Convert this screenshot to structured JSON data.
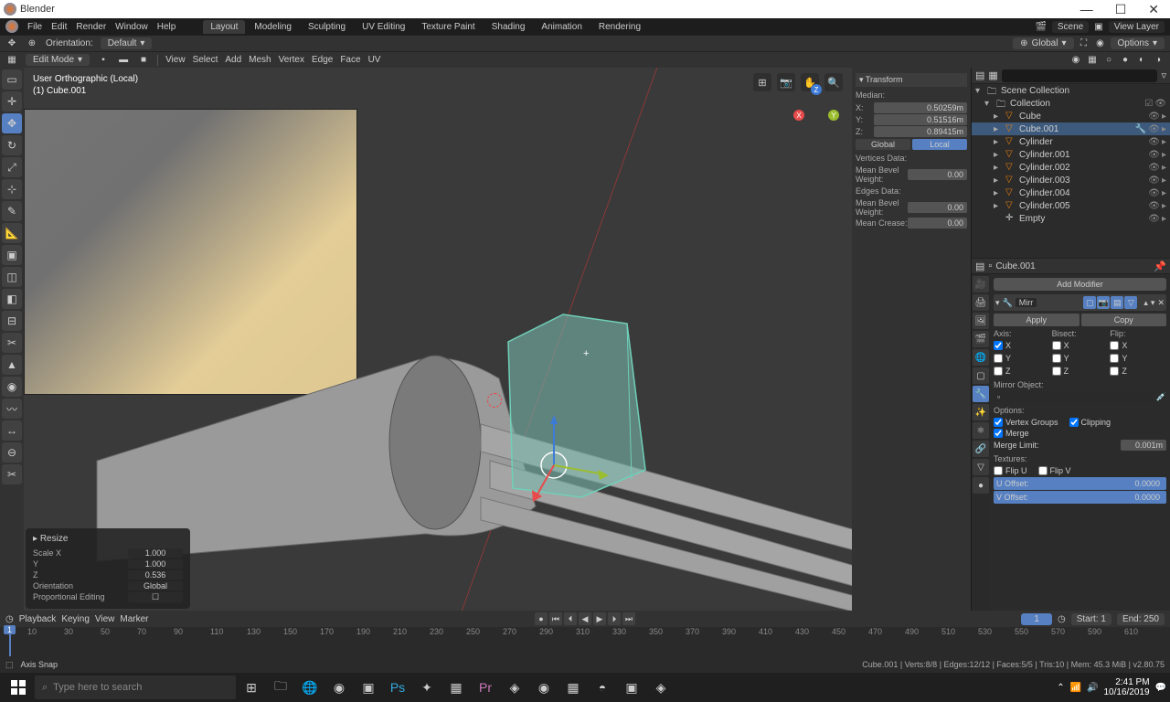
{
  "app": {
    "title": "Blender"
  },
  "winbuttons": {
    "min": "—",
    "max": "☐",
    "close": "✕"
  },
  "topmenu": {
    "items": [
      "File",
      "Edit",
      "Render",
      "Window",
      "Help"
    ]
  },
  "workspaces": [
    "Layout",
    "Modeling",
    "Sculpting",
    "UV Editing",
    "Texture Paint",
    "Shading",
    "Animation",
    "Rendering"
  ],
  "scene": {
    "label": "Scene",
    "viewlayer": "View Layer"
  },
  "toolbar": {
    "orientation_lbl": "Orientation:",
    "orientation_val": "Default",
    "transform_orient": "Global",
    "options": "Options"
  },
  "editmenu": {
    "mode": "Edit Mode",
    "items": [
      "View",
      "Select",
      "Add",
      "Mesh",
      "Vertex",
      "Edge",
      "Face",
      "UV"
    ]
  },
  "viewport": {
    "line1": "User Orthographic (Local)",
    "line2": "(1) Cube.001"
  },
  "npanel": {
    "transform": "Transform",
    "median": "Median:",
    "x": "X:",
    "xv": "0.50259m",
    "y": "Y:",
    "yv": "0.51516m",
    "z": "Z:",
    "zv": "0.89415m",
    "global": "Global",
    "local": "Local",
    "vertsdata": "Vertices Data:",
    "mbw": "Mean Bevel Weight:",
    "mbwv": "0.00",
    "edgesdata": "Edges Data:",
    "mbw2": "Mean Bevel Weight:",
    "mbw2v": "0.00",
    "mc": "Mean Crease:",
    "mcv": "0.00"
  },
  "resize": {
    "title": "Resize",
    "sx": "Scale X",
    "sxv": "1.000",
    "sy": "Y",
    "syv": "1.000",
    "sz": "Z",
    "szv": "0.536",
    "orient": "Orientation",
    "orientv": "Global",
    "prop": "Proportional Editing"
  },
  "outliner": {
    "collection": "Scene Collection",
    "coll": "Collection",
    "items": [
      "Cube",
      "Cube.001",
      "Cylinder",
      "Cylinder.001",
      "Cylinder.002",
      "Cylinder.003",
      "Cylinder.004",
      "Cylinder.005",
      "Empty"
    ]
  },
  "props": {
    "obj": "Cube.001",
    "addmod": "Add Modifier",
    "modname": "Mirr",
    "apply": "Apply",
    "copy": "Copy",
    "axis": "Axis:",
    "bisect": "Bisect:",
    "flip": "Flip:",
    "ax": "X",
    "ay": "Y",
    "az": "Z",
    "mobj": "Mirror Object:",
    "options": "Options:",
    "vg": "Vertex Groups",
    "clip": "Clipping",
    "merge": "Merge",
    "mergelimit": "Merge Limit:",
    "mergelimitv": "0.001m",
    "textures": "Textures:",
    "flipu": "Flip U",
    "flipv": "Flip V",
    "uoff": "U Offset:",
    "uoffv": "0.0000",
    "voff": "V Offset:",
    "voffv": "0.0000"
  },
  "timeline": {
    "playback": "Playback",
    "keying": "Keying",
    "view": "View",
    "marker": "Marker",
    "frame": "1",
    "start": "Start:",
    "startv": "1",
    "end": "End:",
    "endv": "250",
    "ticks": [
      10,
      30,
      50,
      70,
      90,
      110,
      130,
      150,
      170,
      190,
      210,
      230,
      250,
      270,
      290,
      310,
      330,
      350,
      370,
      390,
      410,
      430,
      450,
      470,
      490,
      510,
      530,
      550,
      570,
      590,
      610
    ],
    "ticklbl": [
      "10",
      "30",
      "50",
      "70",
      "90",
      "110",
      "130",
      "150",
      "170",
      "190",
      "210",
      "230",
      "250",
      "270",
      "290",
      "310",
      "330",
      "350",
      "370",
      "390",
      "410",
      "430",
      "450",
      "470",
      "490",
      "510",
      "530",
      "550",
      "570",
      "590",
      "610"
    ]
  },
  "status": {
    "hint": "Axis Snap",
    "info": "Cube.001 | Verts:8/8 | Edges:12/12 | Faces:5/5 | Tris:10 | Mem: 45.3 MiB | v2.80.75"
  },
  "taskbar": {
    "search": "Type here to search",
    "time": "2:41 PM",
    "date": "10/16/2019"
  }
}
